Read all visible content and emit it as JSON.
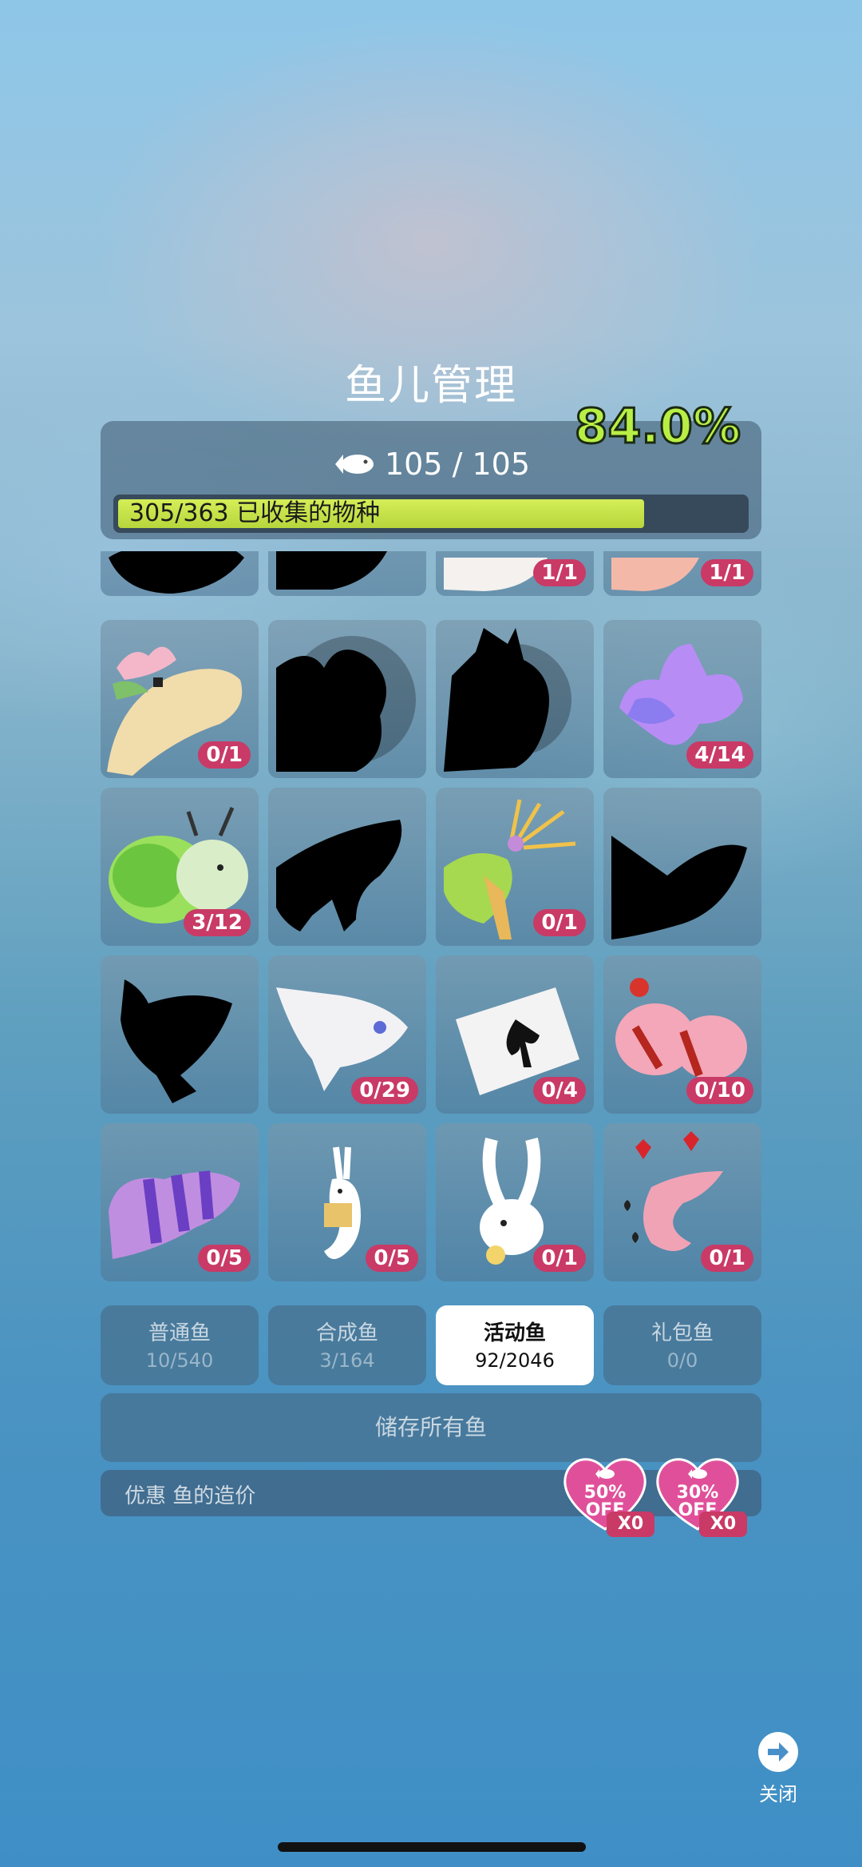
{
  "title": "鱼儿管理",
  "header": {
    "fish_count": "105 / 105",
    "collected_label": "305/363 已收集的物种",
    "collected_percent": "84.0%",
    "progress_fraction": 0.84
  },
  "fish_grid": {
    "partial_row_counts": [
      "",
      "",
      "1/1",
      "1/1"
    ],
    "rows": [
      [
        {
          "name": "cream-dragon-fish",
          "count": "0/1"
        },
        {
          "name": "silhouette-fish",
          "count": ""
        },
        {
          "name": "silhouette-fish",
          "count": ""
        },
        {
          "name": "purple-scorpion-fish",
          "count": "4/14"
        }
      ],
      [
        {
          "name": "green-leafy-sea-slug",
          "count": "3/12"
        },
        {
          "name": "silhouette-fish",
          "count": ""
        },
        {
          "name": "orchid-mantis-fish",
          "count": "0/1"
        },
        {
          "name": "silhouette-fish",
          "count": ""
        }
      ],
      [
        {
          "name": "silhouette-fish",
          "count": ""
        },
        {
          "name": "white-paper-fish",
          "count": "0/29"
        },
        {
          "name": "spade-card-fish",
          "count": "0/4"
        },
        {
          "name": "pink-clown-fish",
          "count": "0/10"
        }
      ],
      [
        {
          "name": "purple-striped-fish",
          "count": "0/5"
        },
        {
          "name": "rabbit-seahorse",
          "count": "0/5"
        },
        {
          "name": "white-rabbit-fish",
          "count": "0/1"
        },
        {
          "name": "heart-seadragon",
          "count": "0/1"
        }
      ]
    ]
  },
  "tabs": [
    {
      "name": "普通鱼",
      "count": "10/540",
      "active": false
    },
    {
      "name": "合成鱼",
      "count": "3/164",
      "active": false
    },
    {
      "name": "活动鱼",
      "count": "92/2046",
      "active": true
    },
    {
      "name": "礼包鱼",
      "count": "0/0",
      "active": false
    }
  ],
  "store_all_label": "储存所有鱼",
  "discount": {
    "label": "优惠 鱼的造价",
    "coupons": [
      {
        "percent": "50%",
        "off": "OFF",
        "qty": "X0"
      },
      {
        "percent": "30%",
        "off": "OFF",
        "qty": "X0"
      }
    ]
  },
  "close_label": "关闭",
  "colors": {
    "badge": "#c93a66",
    "progress": "#c6e24b",
    "percent_text": "#b8ef45"
  }
}
